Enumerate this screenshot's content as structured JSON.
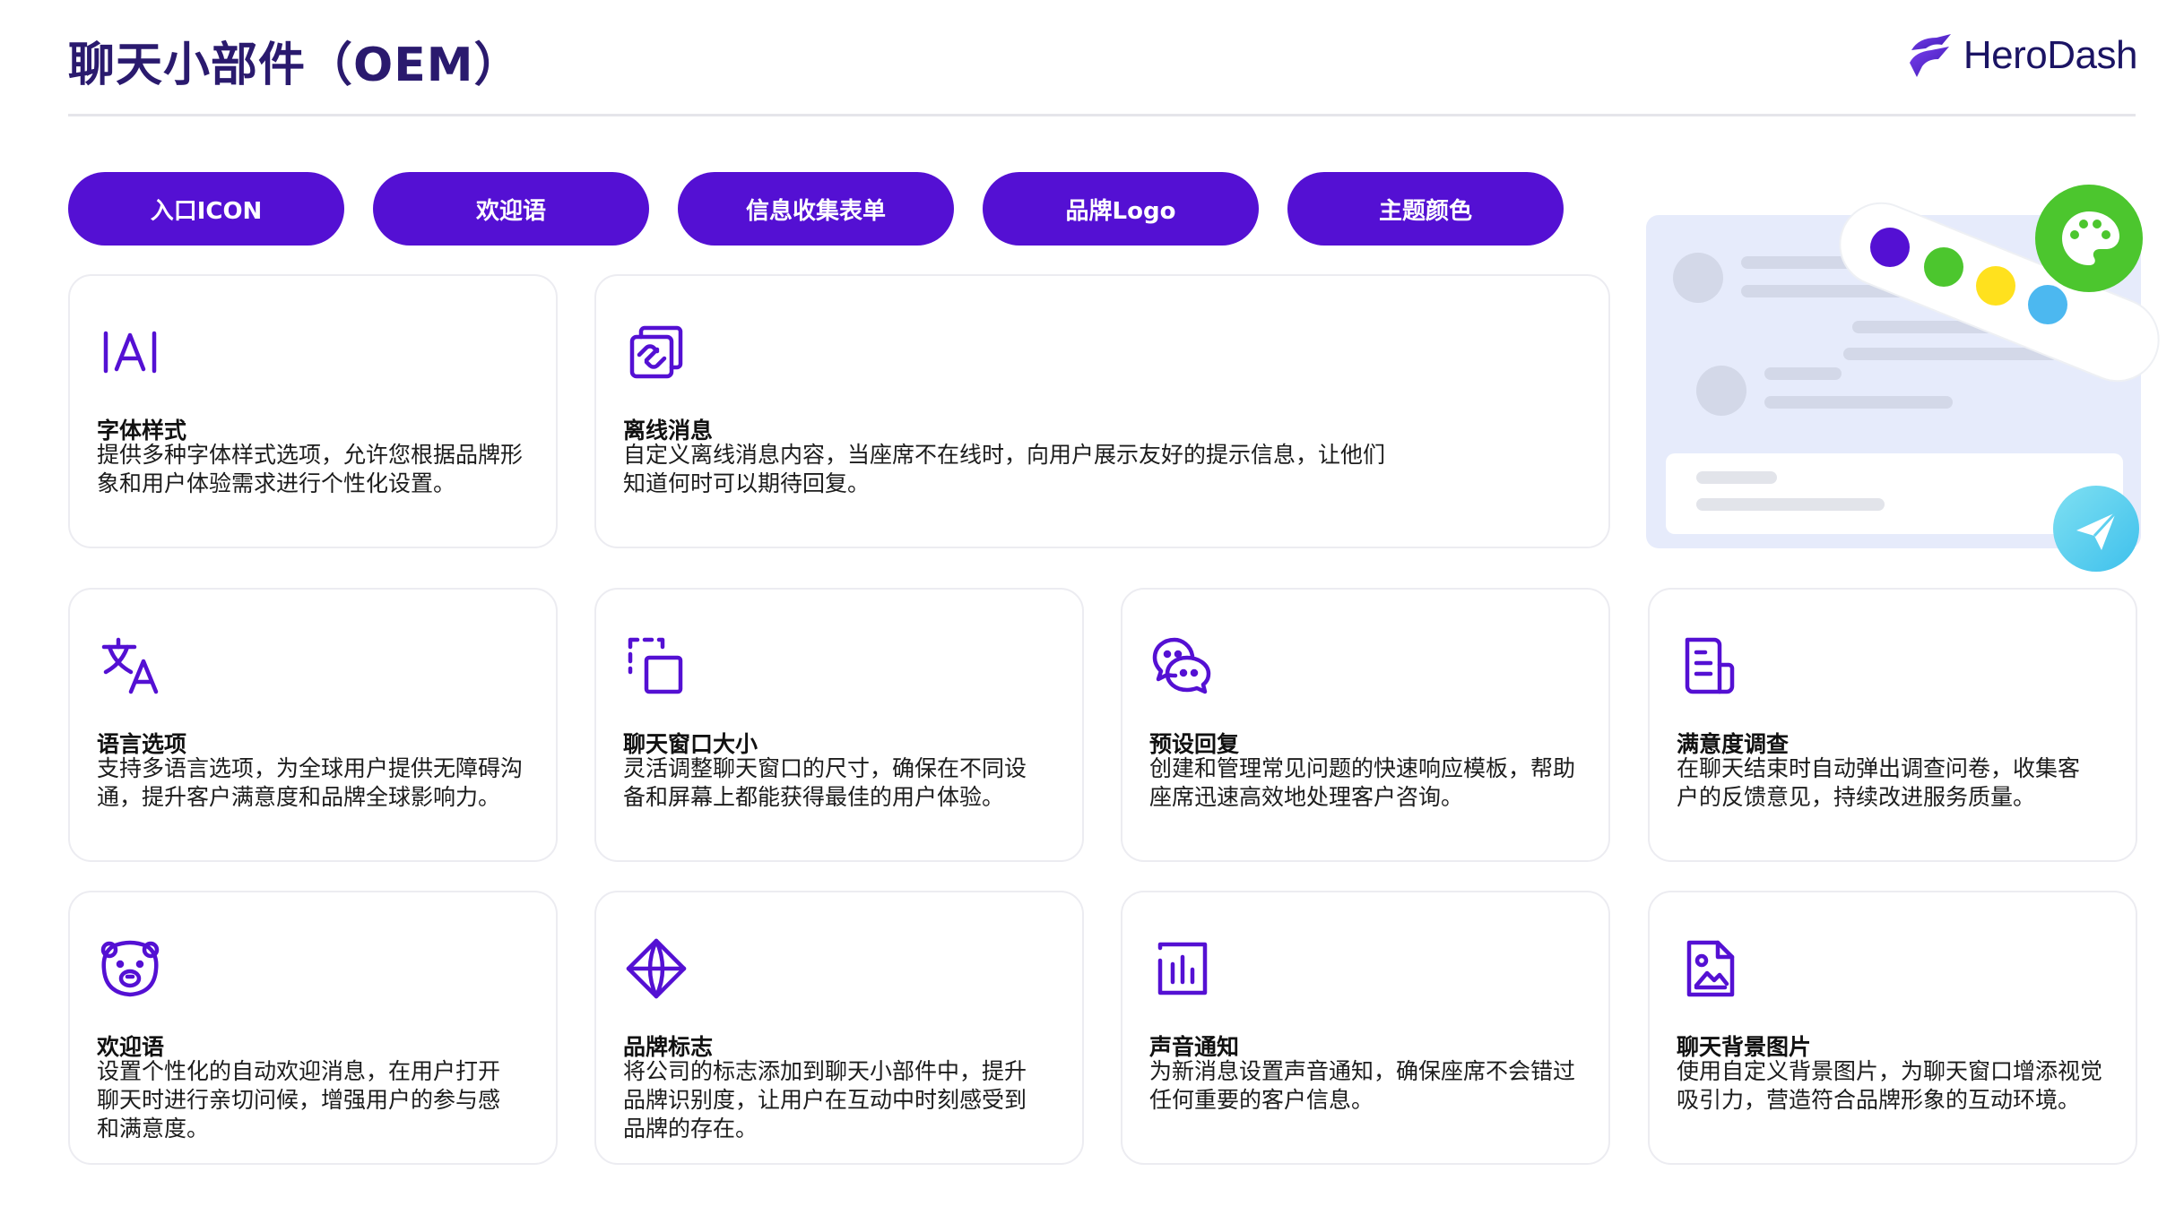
{
  "page": {
    "title": "聊天小部件（OEM）"
  },
  "brand": {
    "name": "HeroDash",
    "primary_color": "#5410d3",
    "logo_colors": [
      "#5b2bd8",
      "#7b3ff0"
    ]
  },
  "tabs": [
    {
      "label": "入口ICON"
    },
    {
      "label": "欢迎语"
    },
    {
      "label": "信息收集表单"
    },
    {
      "label": "品牌Logo"
    },
    {
      "label": "主题颜色"
    }
  ],
  "features": [
    {
      "icon": "font-style-icon",
      "title": "字体样式",
      "desc": "提供多种字体样式选项，允许您根据品牌形\n象和用户体验需求进行个性化设置。"
    },
    {
      "icon": "offline-link-icon",
      "title": "离线消息",
      "desc": "自定义离线消息内容，当座席不在线时，向用户展示友好的提示信息，让他们\n知道何时可以期待回复。"
    },
    {
      "icon": "translate-icon",
      "title": "语言选项",
      "desc": "支持多语言选项，为全球用户提供无障碍沟\n通，提升客户满意度和品牌全球影响力。"
    },
    {
      "icon": "resize-window-icon",
      "title": "聊天窗口大小",
      "desc": "灵活调整聊天窗口的尺寸，确保在不同设\n备和屏幕上都能获得最佳的用户体验。"
    },
    {
      "icon": "chat-bubbles-icon",
      "title": "预设回复",
      "desc": "创建和管理常见问题的快速响应模板，帮助\n座席迅速高效地处理客户咨询。"
    },
    {
      "icon": "survey-document-icon",
      "title": "满意度调查",
      "desc": "在聊天结束时自动弹出调查问卷，收集客\n户的反馈意见，持续改进服务质量。"
    },
    {
      "icon": "bear-face-icon",
      "title": "欢迎语",
      "desc": "设置个性化的自动欢迎消息，在用户打开\n聊天时进行亲切问候，增强用户的参与感\n和满意度。"
    },
    {
      "icon": "diamond-logo-icon",
      "title": "品牌标志",
      "desc": "将公司的标志添加到聊天小部件中，提升\n品牌识别度，让用户在互动中时刻感受到\n品牌的存在。"
    },
    {
      "icon": "sound-bars-icon",
      "title": "声音通知",
      "desc": "为新消息设置声音通知，确保座席不会错过\n任何重要的客户信息。"
    },
    {
      "icon": "background-image-icon",
      "title": "聊天背景图片",
      "desc": "使用自定义背景图片，为聊天窗口增添视觉\n吸引力，营造符合品牌形象的互动环境。"
    }
  ],
  "illustration": {
    "palette_colors": [
      "#5410d3",
      "#4cc62e",
      "#ffe11e",
      "#4cb8f0"
    ],
    "palette_button_color": "#4cc62e",
    "send_button_color": "#5ad0f0",
    "icons": [
      "palette-icon",
      "send-icon"
    ]
  }
}
